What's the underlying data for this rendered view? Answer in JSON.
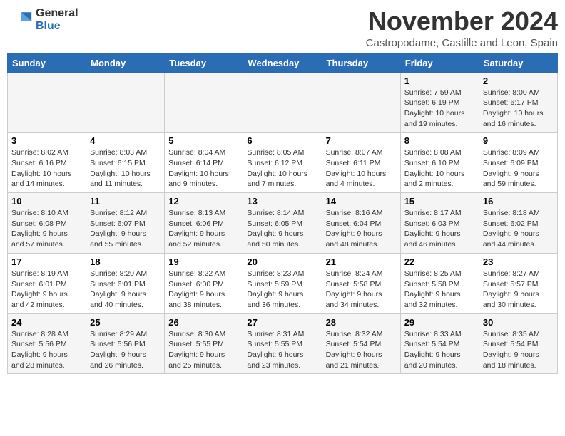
{
  "header": {
    "logo": {
      "general": "General",
      "blue": "Blue"
    },
    "title": "November 2024",
    "subtitle": "Castropodame, Castille and Leon, Spain"
  },
  "weekdays": [
    "Sunday",
    "Monday",
    "Tuesday",
    "Wednesday",
    "Thursday",
    "Friday",
    "Saturday"
  ],
  "weeks": [
    [
      {
        "day": "",
        "info": ""
      },
      {
        "day": "",
        "info": ""
      },
      {
        "day": "",
        "info": ""
      },
      {
        "day": "",
        "info": ""
      },
      {
        "day": "",
        "info": ""
      },
      {
        "day": "1",
        "info": "Sunrise: 7:59 AM\nSunset: 6:19 PM\nDaylight: 10 hours and 19 minutes."
      },
      {
        "day": "2",
        "info": "Sunrise: 8:00 AM\nSunset: 6:17 PM\nDaylight: 10 hours and 16 minutes."
      }
    ],
    [
      {
        "day": "3",
        "info": "Sunrise: 8:02 AM\nSunset: 6:16 PM\nDaylight: 10 hours and 14 minutes."
      },
      {
        "day": "4",
        "info": "Sunrise: 8:03 AM\nSunset: 6:15 PM\nDaylight: 10 hours and 11 minutes."
      },
      {
        "day": "5",
        "info": "Sunrise: 8:04 AM\nSunset: 6:14 PM\nDaylight: 10 hours and 9 minutes."
      },
      {
        "day": "6",
        "info": "Sunrise: 8:05 AM\nSunset: 6:12 PM\nDaylight: 10 hours and 7 minutes."
      },
      {
        "day": "7",
        "info": "Sunrise: 8:07 AM\nSunset: 6:11 PM\nDaylight: 10 hours and 4 minutes."
      },
      {
        "day": "8",
        "info": "Sunrise: 8:08 AM\nSunset: 6:10 PM\nDaylight: 10 hours and 2 minutes."
      },
      {
        "day": "9",
        "info": "Sunrise: 8:09 AM\nSunset: 6:09 PM\nDaylight: 9 hours and 59 minutes."
      }
    ],
    [
      {
        "day": "10",
        "info": "Sunrise: 8:10 AM\nSunset: 6:08 PM\nDaylight: 9 hours and 57 minutes."
      },
      {
        "day": "11",
        "info": "Sunrise: 8:12 AM\nSunset: 6:07 PM\nDaylight: 9 hours and 55 minutes."
      },
      {
        "day": "12",
        "info": "Sunrise: 8:13 AM\nSunset: 6:06 PM\nDaylight: 9 hours and 52 minutes."
      },
      {
        "day": "13",
        "info": "Sunrise: 8:14 AM\nSunset: 6:05 PM\nDaylight: 9 hours and 50 minutes."
      },
      {
        "day": "14",
        "info": "Sunrise: 8:16 AM\nSunset: 6:04 PM\nDaylight: 9 hours and 48 minutes."
      },
      {
        "day": "15",
        "info": "Sunrise: 8:17 AM\nSunset: 6:03 PM\nDaylight: 9 hours and 46 minutes."
      },
      {
        "day": "16",
        "info": "Sunrise: 8:18 AM\nSunset: 6:02 PM\nDaylight: 9 hours and 44 minutes."
      }
    ],
    [
      {
        "day": "17",
        "info": "Sunrise: 8:19 AM\nSunset: 6:01 PM\nDaylight: 9 hours and 42 minutes."
      },
      {
        "day": "18",
        "info": "Sunrise: 8:20 AM\nSunset: 6:01 PM\nDaylight: 9 hours and 40 minutes."
      },
      {
        "day": "19",
        "info": "Sunrise: 8:22 AM\nSunset: 6:00 PM\nDaylight: 9 hours and 38 minutes."
      },
      {
        "day": "20",
        "info": "Sunrise: 8:23 AM\nSunset: 5:59 PM\nDaylight: 9 hours and 36 minutes."
      },
      {
        "day": "21",
        "info": "Sunrise: 8:24 AM\nSunset: 5:58 PM\nDaylight: 9 hours and 34 minutes."
      },
      {
        "day": "22",
        "info": "Sunrise: 8:25 AM\nSunset: 5:58 PM\nDaylight: 9 hours and 32 minutes."
      },
      {
        "day": "23",
        "info": "Sunrise: 8:27 AM\nSunset: 5:57 PM\nDaylight: 9 hours and 30 minutes."
      }
    ],
    [
      {
        "day": "24",
        "info": "Sunrise: 8:28 AM\nSunset: 5:56 PM\nDaylight: 9 hours and 28 minutes."
      },
      {
        "day": "25",
        "info": "Sunrise: 8:29 AM\nSunset: 5:56 PM\nDaylight: 9 hours and 26 minutes."
      },
      {
        "day": "26",
        "info": "Sunrise: 8:30 AM\nSunset: 5:55 PM\nDaylight: 9 hours and 25 minutes."
      },
      {
        "day": "27",
        "info": "Sunrise: 8:31 AM\nSunset: 5:55 PM\nDaylight: 9 hours and 23 minutes."
      },
      {
        "day": "28",
        "info": "Sunrise: 8:32 AM\nSunset: 5:54 PM\nDaylight: 9 hours and 21 minutes."
      },
      {
        "day": "29",
        "info": "Sunrise: 8:33 AM\nSunset: 5:54 PM\nDaylight: 9 hours and 20 minutes."
      },
      {
        "day": "30",
        "info": "Sunrise: 8:35 AM\nSunset: 5:54 PM\nDaylight: 9 hours and 18 minutes."
      }
    ]
  ]
}
